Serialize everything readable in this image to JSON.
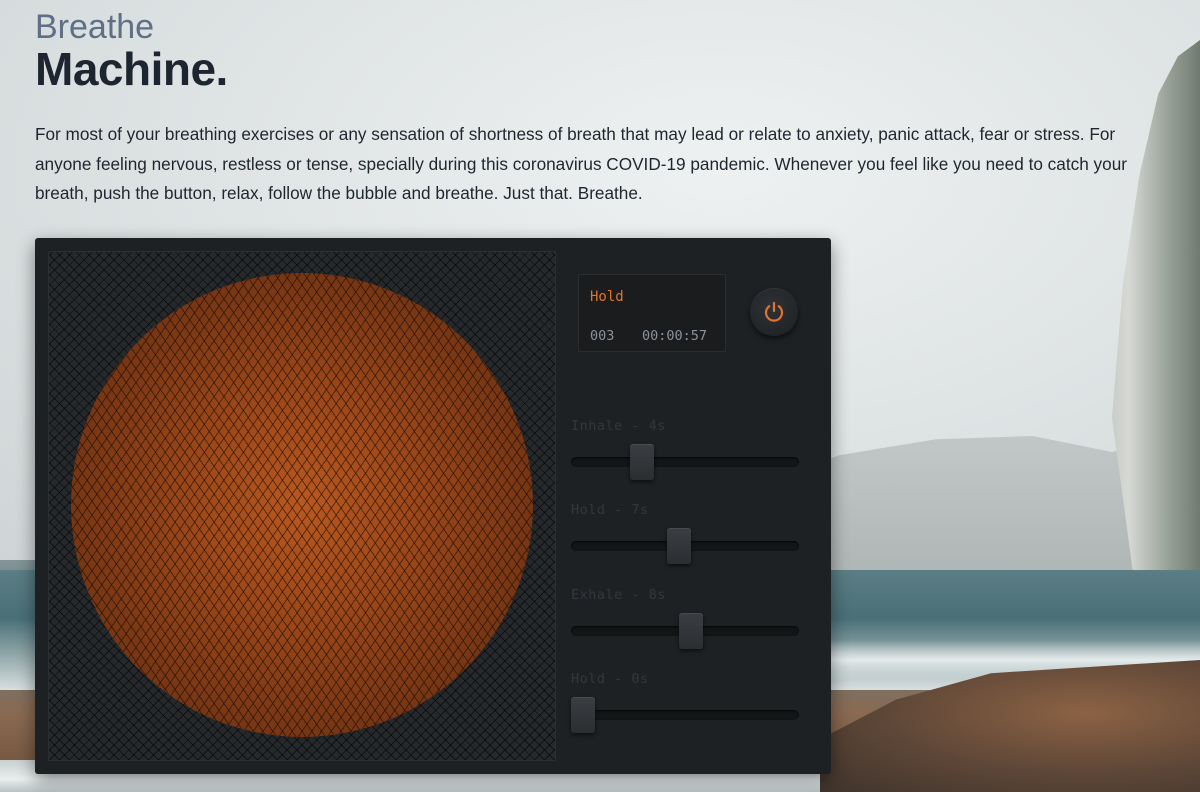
{
  "header": {
    "title_light": "Breathe",
    "title_bold": "Machine.",
    "intro": "For most of your breathing exercises or any sensation of shortness of breath that may lead or relate to anxiety, panic attack, fear or stress. For anyone feeling nervous, restless or tense, specially during this coronavirus COVID-19 pandemic. Whenever you feel like you need to catch your breath, push the button, relax, follow the bubble and breathe. Just that. Breathe."
  },
  "display": {
    "phase": "Hold",
    "count": "003",
    "timer": "00:00:57"
  },
  "power_button": {
    "icon": "power-icon",
    "color": "#e0732f"
  },
  "sliders": [
    {
      "label": "Inhale - 4s",
      "value_fraction": 0.29
    },
    {
      "label": "Hold - 7s",
      "value_fraction": 0.47
    },
    {
      "label": "Exhale - 8s",
      "value_fraction": 0.53
    },
    {
      "label": "Hold - 0s",
      "value_fraction": 0.0
    }
  ],
  "colors": {
    "accent": "#e0732f",
    "machine": "#1e2124"
  }
}
